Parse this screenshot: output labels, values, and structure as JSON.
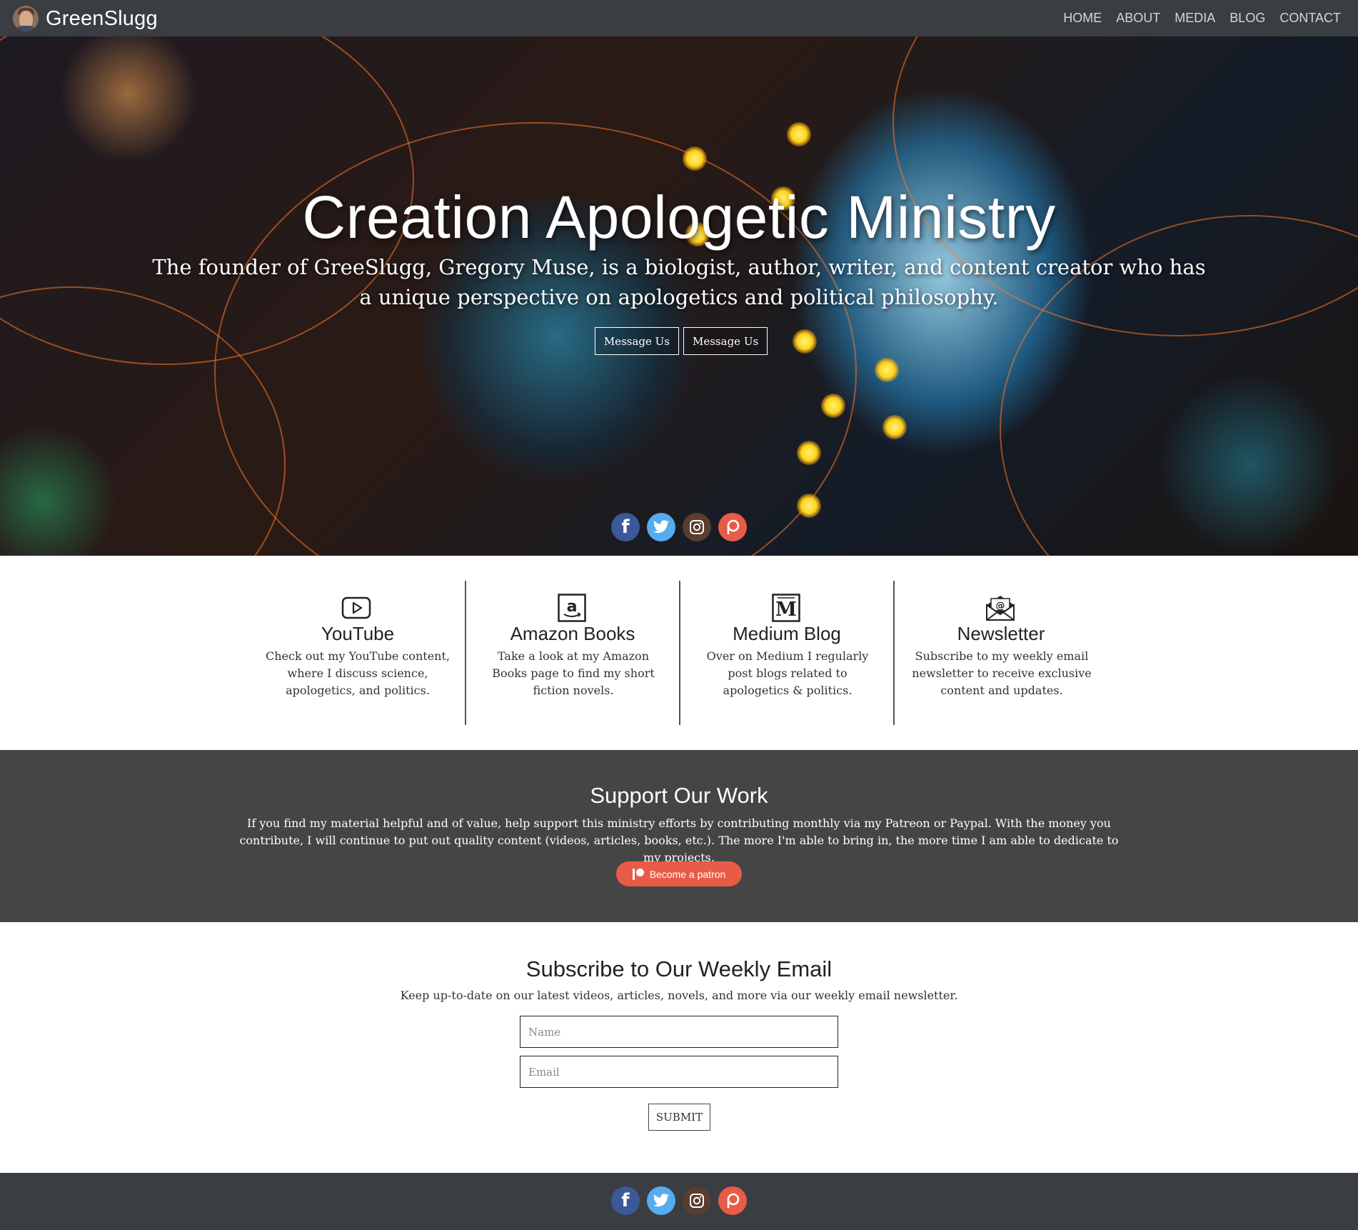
{
  "nav": {
    "brand": "GreenSlugg",
    "links": [
      "HOME",
      "ABOUT",
      "MEDIA",
      "BLOG",
      "CONTACT"
    ]
  },
  "hero": {
    "title": "Creation Apologetic Ministry",
    "subtitle": "The founder of GreeSlugg, Gregory Muse, is a biologist, author, writer, and content creator who has a unique perspective on apologetics and political philosophy.",
    "buttons": [
      "Message Us",
      "Message Us"
    ],
    "social_icons": [
      "facebook-icon",
      "twitter-icon",
      "instagram-icon",
      "patreon-icon"
    ]
  },
  "features": [
    {
      "icon": "youtube-icon",
      "title": "YouTube",
      "text": "Check out my YouTube content, where I discuss science, apologetics, and politics."
    },
    {
      "icon": "amazon-icon",
      "title": "Amazon Books",
      "text": "Take a look at my Amazon Books page to find my short fiction novels."
    },
    {
      "icon": "medium-icon",
      "title": "Medium Blog",
      "text": "Over on Medium I regularly post blogs related to apologetics & politics."
    },
    {
      "icon": "newsletter-icon",
      "title": "Newsletter",
      "text": "Subscribe to my weekly email newsletter to receive exclusive content and updates."
    }
  ],
  "support": {
    "title": "Support Our Work",
    "text": "If you find my material helpful and of value, help support this ministry efforts by contributing monthly via my Patreon or Paypal. With the money you contribute, I will continue to put out quality content (videos, articles, books, etc.). The more I'm able to bring in, the more time I am able to dedicate to my projects.",
    "button": "Become a patron"
  },
  "subscribe": {
    "title": "Subscribe to Our Weekly Email",
    "text": "Keep up-to-date on our latest videos, articles, novels, and more via our weekly email newsletter.",
    "name_placeholder": "Name",
    "email_placeholder": "Email",
    "submit": "SUBMIT"
  },
  "colors": {
    "nav_bg": "#3a3d42",
    "support_bg": "#454545",
    "patreon": "#e85b46",
    "facebook": "#3b5998",
    "twitter": "#55acee",
    "instagram": "#5a3d2f"
  }
}
